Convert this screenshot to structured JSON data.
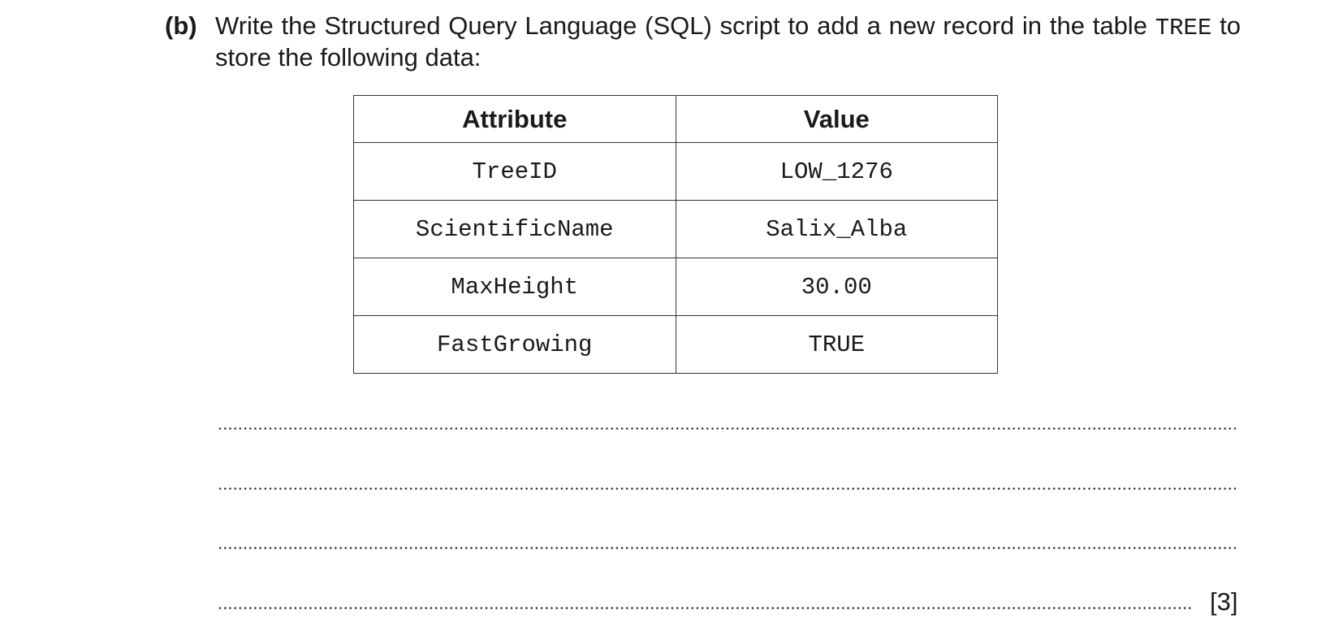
{
  "question": {
    "label": "(b)",
    "text_before": "Write the Structured Query Language (SQL) script to add a new record in the table ",
    "table_name": "TREE",
    "text_after": " to store the following data:"
  },
  "table": {
    "headers": [
      "Attribute",
      "Value"
    ],
    "rows": [
      [
        "TreeID",
        "LOW_1276"
      ],
      [
        "ScientificName",
        "Salix_Alba"
      ],
      [
        "MaxHeight",
        "30.00"
      ],
      [
        "FastGrowing",
        "TRUE"
      ]
    ]
  },
  "marks": "[3]"
}
